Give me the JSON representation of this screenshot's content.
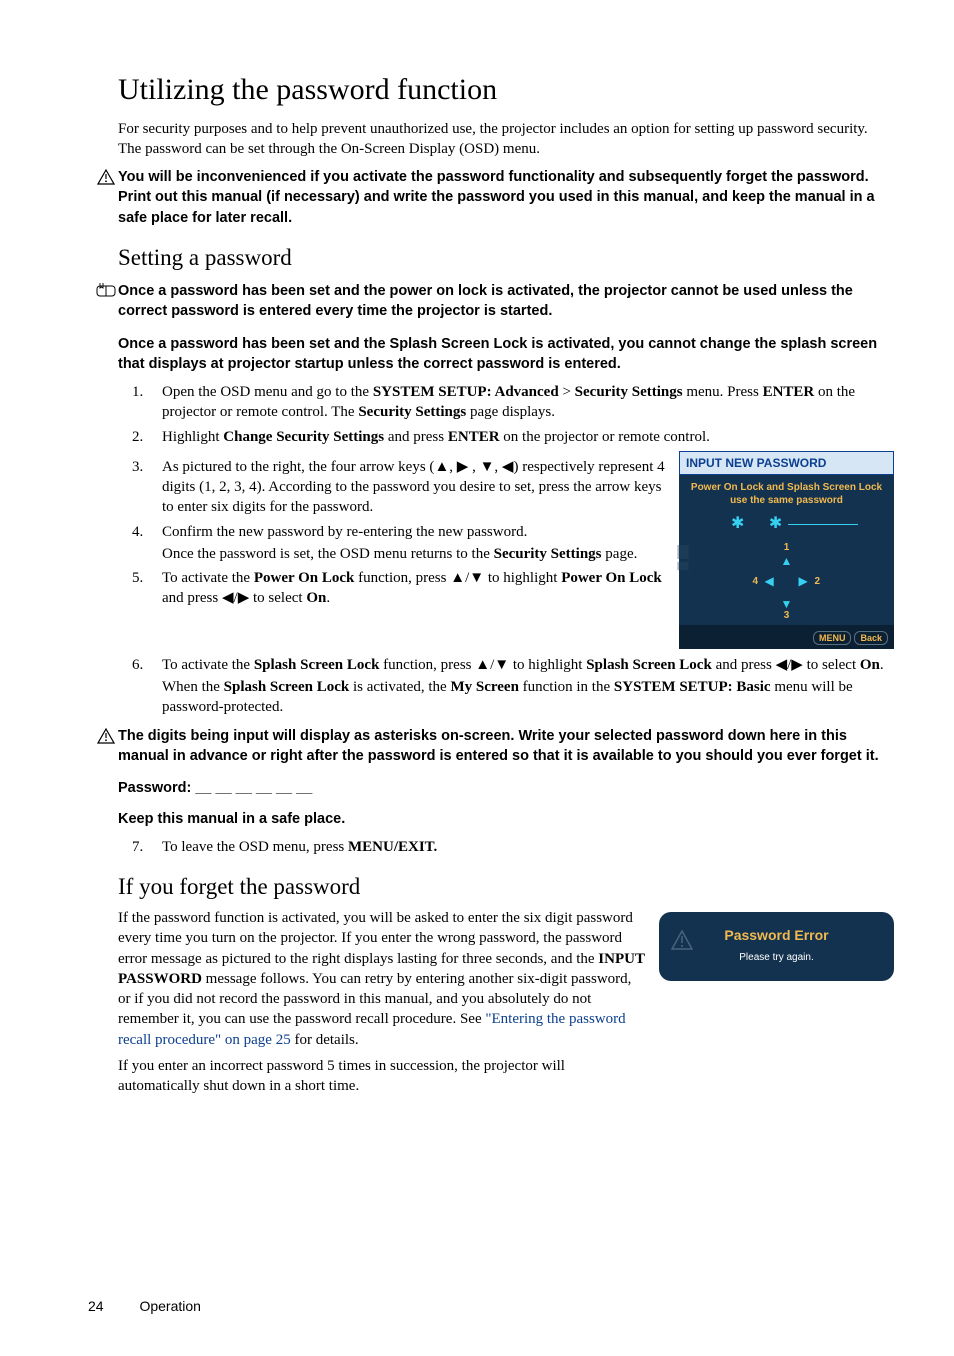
{
  "title": "Utilizing the password function",
  "intro_p": "For security purposes and to help prevent unauthorized use, the projector includes an option for setting up password security. The password can be set through the On-Screen Display (OSD) menu.",
  "warn1": "You will be inconvenienced if you activate the password functionality and subsequently forget the password. Print out this manual (if necessary) and write the password you used in this manual, and keep the manual in a safe place for later recall.",
  "h2a": "Setting a password",
  "note1": "Once a password has been set and the power on lock is activated, the projector cannot be used unless the correct password is entered every time the projector is started.",
  "note2": "Once a password has been set and the Splash Screen Lock is activated, you cannot change the splash screen that displays at projector startup unless the correct password is entered.",
  "step1_a": "Open the OSD menu and go to the ",
  "step1_b": "SYSTEM SETUP: Advanced",
  "step1_c": " > ",
  "step1_d": "Security Settings",
  "step1_e": " menu. Press ",
  "step1_f": "ENTER",
  "step1_g": " on the projector or remote control. The ",
  "step1_h": "Security Settings",
  "step1_i": " page displays.",
  "step2_a": "Highlight ",
  "step2_b": "Change Security Settings",
  "step2_c": " and press ",
  "step2_d": "ENTER",
  "step2_e": " on the projector or remote control.",
  "step3_a": "As pictured to the right, the four arrow keys (",
  "step3_arrows": "▲, ▶ , ▼, ◀",
  "step3_b": ") respectively represent 4 digits (1, 2, 3, 4). According to the password you desire to set, press the arrow keys to enter six digits for the password.",
  "step4_a": "Confirm the new password by re-entering the new password.",
  "step4_b_a": "Once the password is set, the OSD menu returns to the ",
  "step4_b_b": "Security Settings",
  "step4_b_c": " page.",
  "step5_a": "To activate the ",
  "step5_b": "Power On Lock",
  "step5_c": " function, press ",
  "step5_arrows1": "▲/▼",
  "step5_d": " to highlight ",
  "step5_e": "Power On Lock",
  "step5_f": " and press ",
  "step5_arrows2": "◀/▶",
  "step5_g": " to select ",
  "step5_h": "On",
  "step5_i": ".",
  "step6_a": "To activate the ",
  "step6_b": "Splash Screen Lock",
  "step6_c": " function, press ",
  "step6_arrows1": "▲/▼",
  "step6_d": " to highlight ",
  "step6_e": "Splash Screen Lock",
  "step6_f": " and press ",
  "step6_arrows2": "◀/▶",
  "step6_g": "  to select ",
  "step6_h": "On",
  "step6_i": ".",
  "step6_p2_a": "When the ",
  "step6_p2_b": "Splash Screen Lock",
  "step6_p2_c": " is activated, the ",
  "step6_p2_d": "My Screen",
  "step6_p2_e": " function in the ",
  "step6_p2_f": "SYSTEM SETUP: Basic",
  "step6_p2_g": " menu will be password-protected.",
  "warn2": "The digits being input will display as asterisks on-screen. Write your selected password down here in this manual in advance or right after the password is entered so that it is available to you should you ever forget it.",
  "pwd_label": "Password: __ __ __ __ __ __",
  "keep": "Keep this manual in a safe place.",
  "step7_a": "To leave the OSD menu, press ",
  "step7_b": "MENU/EXIT.",
  "h2b": "If you forget the password",
  "forget_p1_a": "If the password function is activated, you will be asked to enter the six digit password every time you turn on the projector. If you enter the wrong password, the password error message as pictured to the right displays lasting for three seconds, and the ",
  "forget_p1_b": "INPUT PASSWORD",
  "forget_p1_c": " message follows. You can retry by entering another six-digit password, or if you did not record the password in this manual, and you absolutely do not remember it, you can use the password recall procedure. See ",
  "forget_link": "\"Entering the password recall procedure\" on page 25",
  "forget_p1_d": " for details.",
  "forget_p2": "If you enter an incorrect password 5 times in succession, the projector will automatically shut down in a short time.",
  "osd": {
    "title": "INPUT NEW PASSWORD",
    "sub": "Power On Lock and Splash Screen Lock use the same password",
    "stars": "✱ ✱",
    "n1": "1",
    "n2": "2",
    "n3": "3",
    "n4": "4",
    "menu": "MENU",
    "back": "Back"
  },
  "err": {
    "title": "Password Error",
    "msg": "Please try again."
  },
  "footer_page": "24",
  "footer_section": "Operation"
}
